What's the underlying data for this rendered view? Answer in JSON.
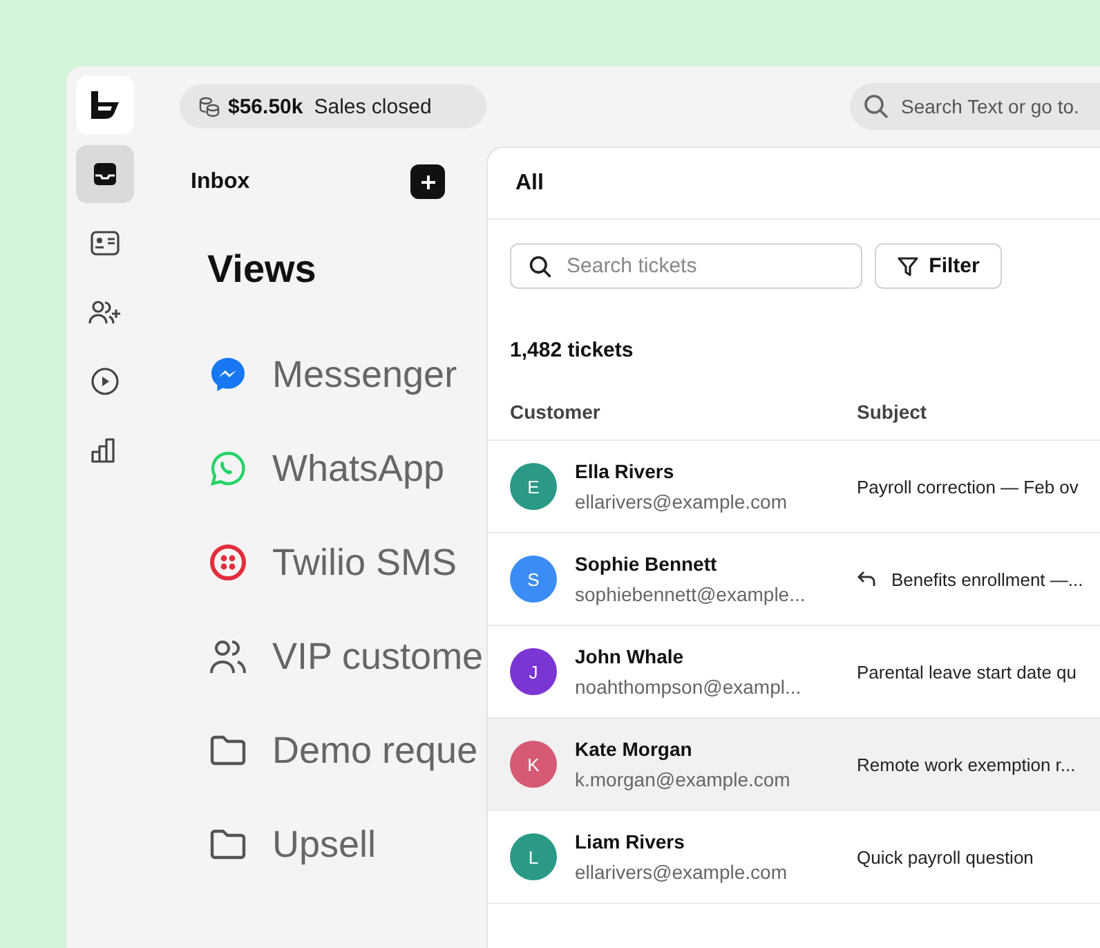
{
  "rail": [
    {
      "kind": "inbox",
      "selected": true
    },
    {
      "kind": "contact-card",
      "selected": false
    },
    {
      "kind": "users-plus",
      "selected": false
    },
    {
      "kind": "play",
      "selected": false
    },
    {
      "kind": "chart",
      "selected": false
    }
  ],
  "top_bar": {
    "sales_amount": "$56.50k",
    "sales_label": "Sales closed",
    "search": {
      "placeholder": "Search Text or go to."
    }
  },
  "inbox": {
    "title": "Inbox",
    "views_title": "Views",
    "views": [
      {
        "kind": "messenger",
        "label": "Messenger"
      },
      {
        "kind": "whatsapp",
        "label": "WhatsApp"
      },
      {
        "kind": "twilio",
        "label": "Twilio SMS"
      },
      {
        "kind": "people",
        "label": "VIP custome"
      },
      {
        "kind": "folder",
        "label": "Demo reque"
      },
      {
        "kind": "folder",
        "label": "Upsell"
      }
    ]
  },
  "tickets": {
    "title": "All",
    "search": {
      "placeholder": "Search tickets"
    },
    "filter_label": "Filter",
    "count": "1,482 tickets",
    "columns": [
      "Customer",
      "Subject"
    ],
    "rows": [
      {
        "initial": "E",
        "color": "#2a9a86",
        "name": "Ella Rivers",
        "email": "ellarivers@example.com",
        "subject": "Payroll correction — Feb ov",
        "replied": false,
        "selected": false
      },
      {
        "initial": "S",
        "color": "#3b8df5",
        "name": "Sophie Bennett",
        "email": "sophiebennett@example...",
        "subject": "Benefits enrollment —...",
        "replied": true,
        "selected": false
      },
      {
        "initial": "J",
        "color": "#7b35d3",
        "name": "John Whale",
        "email": "noahthompson@exampl...",
        "subject": "Parental leave start date qu",
        "replied": false,
        "selected": false
      },
      {
        "initial": "K",
        "color": "#d65a73",
        "name": "Kate Morgan",
        "email": "k.morgan@example.com",
        "subject": "Remote work exemption r...",
        "replied": false,
        "selected": true
      },
      {
        "initial": "L",
        "color": "#2a9a86",
        "name": "Liam Rivers",
        "email": "ellarivers@example.com",
        "subject": "Quick payroll question",
        "replied": false,
        "selected": false
      }
    ]
  }
}
